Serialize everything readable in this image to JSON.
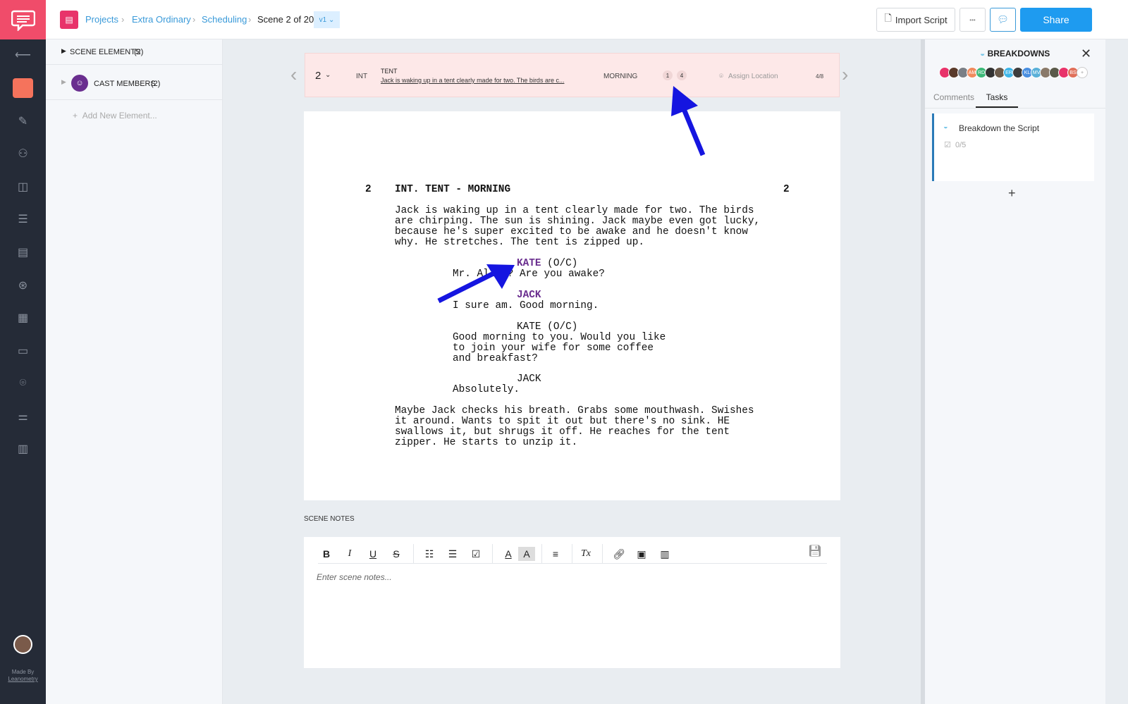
{
  "nav": {
    "items": [
      "back",
      "stripboard",
      "edit",
      "cast",
      "board",
      "schedule",
      "list",
      "elements",
      "calendar",
      "folder",
      "location",
      "settings",
      "book"
    ],
    "made_by": "Made By",
    "company": "Leanometry"
  },
  "header": {
    "breadcrumbs": [
      "Projects",
      "Extra Ordinary",
      "Scheduling"
    ],
    "current": "Scene 2 of 20",
    "version": "v1",
    "import_label": "Import Script",
    "more_label": "•••",
    "share_label": "Share",
    "accent": "#1e9bf0"
  },
  "left": {
    "scene_elements": "SCENE ELEMENTS",
    "scene_elements_count": "(2)",
    "cast_members": "CAST MEMBERS",
    "cast_count": "(2)",
    "add_new": "Add New Element..."
  },
  "scene_bar": {
    "number": "2",
    "int_ext": "INT",
    "set": "TENT",
    "synopsis": "Jack is waking up in a tent clearly made for two. The birds are c...",
    "time": "MORNING",
    "cast_ids": [
      "1",
      "4"
    ],
    "location": "Assign Location",
    "pages": "4/8",
    "color": "#fde8e8"
  },
  "script": {
    "scene_num": "2",
    "heading": "INT. TENT - MORNING",
    "action1": [
      "Jack is waking up in a tent clearly made for two. The birds",
      "are chirping. The sun is shining. Jack maybe even got lucky,",
      "because he's super excited to be awake and he doesn't know",
      "why. He stretches. The tent is zipped up."
    ],
    "c1": "KATE",
    "c1ext": " (O/C)",
    "d1": "Mr. Allen? Are you awake?",
    "c2": "JACK",
    "d2": "I sure am. Good morning.",
    "c3": "KATE (O/C)",
    "d3": [
      "Good morning to you. Would you like",
      "to join your wife for some coffee",
      "and breakfast?"
    ],
    "c4": "JACK",
    "d4": "Absolutely.",
    "action2": [
      "Maybe Jack checks his breath. Grabs some mouthwash. Swishes",
      "it around. Wants to spit it out but there's no sink. HE",
      "swallows it, but shrugs it off. He reaches for the tent",
      "zipper. He starts to unzip it."
    ]
  },
  "notes": {
    "label": "SCENE NOTES",
    "placeholder": "Enter scene notes...",
    "toolbar": [
      "B",
      "I",
      "U",
      "S",
      "ordered-list",
      "bullet-list",
      "check-list",
      "A",
      "A",
      "align",
      "Tx",
      "link",
      "image",
      "film"
    ]
  },
  "right": {
    "title": "BREAKDOWNS",
    "avatars": [
      {
        "t": "",
        "c": "#e8336a"
      },
      {
        "t": "",
        "c": "#5a3a2a"
      },
      {
        "t": "",
        "c": "#7a7f86"
      },
      {
        "t": "AM",
        "c": "#f08a5d"
      },
      {
        "t": "RD",
        "c": "#3cb878"
      },
      {
        "t": "",
        "c": "#333"
      },
      {
        "t": "",
        "c": "#6a5a4a"
      },
      {
        "t": "ER",
        "c": "#3fb6e8"
      },
      {
        "t": "",
        "c": "#3d3d3d"
      },
      {
        "t": "KL",
        "c": "#4a8fe0"
      },
      {
        "t": "MV",
        "c": "#5ab0d8"
      },
      {
        "t": "",
        "c": "#8a7a6a"
      },
      {
        "t": "",
        "c": "#5a5a4a"
      },
      {
        "t": "",
        "c": "#e8336a"
      },
      {
        "t": "BS",
        "c": "#e0705a"
      }
    ],
    "tabs": [
      "Comments",
      "Tasks"
    ],
    "active_tab": "Tasks",
    "task_title": "Breakdown the Script",
    "task_progress": "0/5",
    "add": "+"
  }
}
